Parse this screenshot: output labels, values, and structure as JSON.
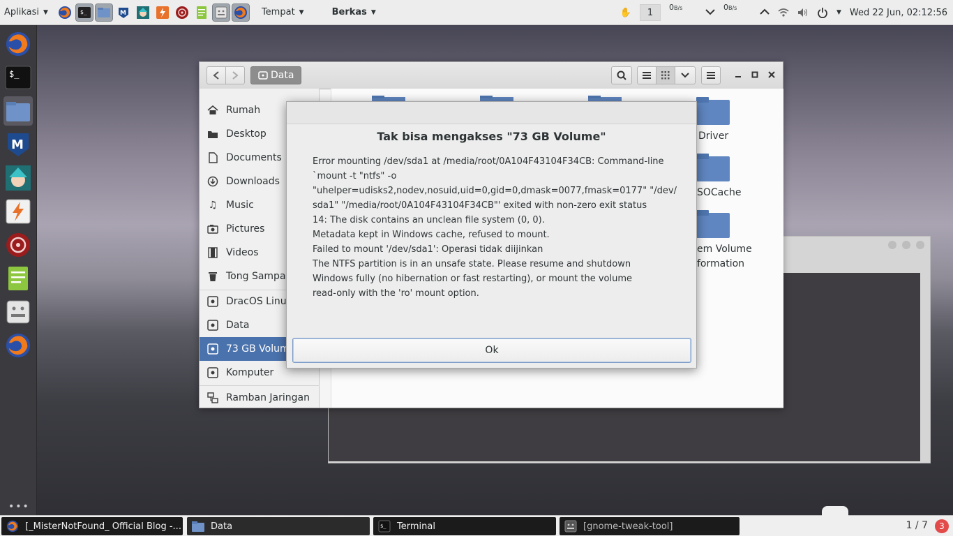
{
  "top_panel": {
    "apps_menu": "Aplikasi",
    "places_menu": "Tempat",
    "files_menu": "Berkas",
    "workspace": "1",
    "net_down": "0",
    "net_up": "0",
    "net_unit": "B/s",
    "clock": "Wed 22 Jun, 02:12:56",
    "launchers": [
      "firefox-icon",
      "terminal-icon",
      "files-icon",
      "malwarebytes-icon",
      "anime-avatar-icon",
      "burp-icon",
      "armitage-icon",
      "text-editor-icon",
      "tweak-tool-icon",
      "firefox-icon"
    ]
  },
  "dock": {
    "items": [
      "firefox-icon",
      "terminal-icon",
      "files-icon",
      "malwarebytes-icon",
      "anime-avatar-icon",
      "burp-icon",
      "armitage-icon",
      "text-editor-icon",
      "tweak-tool-icon",
      "firefox-icon"
    ]
  },
  "file_manager": {
    "location": "Data",
    "sidebar": [
      {
        "label": "Rumah",
        "icon": "home-icon"
      },
      {
        "label": "Desktop",
        "icon": "folder-icon"
      },
      {
        "label": "Documents",
        "icon": "document-icon"
      },
      {
        "label": "Downloads",
        "icon": "download-icon"
      },
      {
        "label": "Music",
        "icon": "music-icon"
      },
      {
        "label": "Pictures",
        "icon": "camera-icon"
      },
      {
        "label": "Videos",
        "icon": "film-icon"
      },
      {
        "label": "Tong Sampah",
        "icon": "trash-icon"
      },
      {
        "label": "DracOS Linux",
        "icon": "drive-icon"
      },
      {
        "label": "Data",
        "icon": "drive-icon"
      },
      {
        "label": "73 GB Volume",
        "icon": "drive-icon",
        "selected": true
      },
      {
        "label": "Komputer",
        "icon": "drive-icon"
      },
      {
        "label": "Ramban Jaringan",
        "icon": "network-icon"
      }
    ],
    "folders": [
      "Driver",
      "SOCache",
      "em Volume",
      "formation"
    ]
  },
  "dialog": {
    "title": "Tak bisa mengakses \"73 GB Volume\"",
    "lines": [
      "Error mounting /dev/sda1 at /media/root/0A104F43104F34CB: Command-line",
      "`mount -t \"ntfs\" -o",
      "\"uhelper=udisks2,nodev,nosuid,uid=0,gid=0,dmask=0077,fmask=0177\" \"/dev/",
      "sda1\" \"/media/root/0A104F43104F34CB\"' exited with non-zero exit status",
      "14: The disk contains an unclean file system (0, 0).",
      "Metadata kept in Windows cache, refused to mount.",
      "Failed to mount '/dev/sda1': Operasi tidak diijinkan",
      "The NTFS partition is in an unsafe state. Please resume and shutdown",
      "Windows fully (no hibernation or fast restarting), or mount the volume",
      "read-only with the 'ro' mount option."
    ],
    "ok_label": "Ok"
  },
  "taskbar": {
    "tasks": [
      {
        "label": "[_MisterNotFound_ Official Blog -...",
        "icon": "firefox-icon"
      },
      {
        "label": "Data",
        "icon": "files-icon"
      },
      {
        "label": "Terminal",
        "icon": "terminal-icon"
      },
      {
        "label": "[gnome-tweak-tool]",
        "icon": "tweak-tool-icon"
      }
    ],
    "pager": "1 / 7",
    "notifications": "3"
  }
}
